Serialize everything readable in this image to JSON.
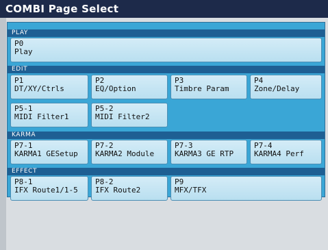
{
  "title": "COMBI Page Select",
  "sections": {
    "play": {
      "label": "PLAY",
      "buttons": [
        {
          "code": "P0",
          "name": "Play"
        }
      ]
    },
    "edit": {
      "label": "EDIT",
      "buttons": [
        {
          "code": "P1",
          "name": "DT/XY/Ctrls"
        },
        {
          "code": "P2",
          "name": "EQ/Option"
        },
        {
          "code": "P3",
          "name": "Timbre Param"
        },
        {
          "code": "P4",
          "name": "Zone/Delay"
        },
        {
          "code": "P5-1",
          "name": "MIDI Filter1"
        },
        {
          "code": "P5-2",
          "name": "MIDI Filter2"
        }
      ]
    },
    "karma": {
      "label": "KARMA",
      "buttons": [
        {
          "code": "P7-1",
          "name": "KARMA1 GESetup"
        },
        {
          "code": "P7-2",
          "name": "KARMA2 Module"
        },
        {
          "code": "P7-3",
          "name": "KARMA3 GE RTP"
        },
        {
          "code": "P7-4",
          "name": "KARMA4 Perf"
        }
      ]
    },
    "effect": {
      "label": "EFFECT",
      "buttons": [
        {
          "code": "P8-1",
          "name": "IFX Route1/1-5"
        },
        {
          "code": "P8-2",
          "name": "IFX Route2"
        },
        {
          "code": "P9",
          "name": "MFX/TFX"
        }
      ]
    }
  }
}
